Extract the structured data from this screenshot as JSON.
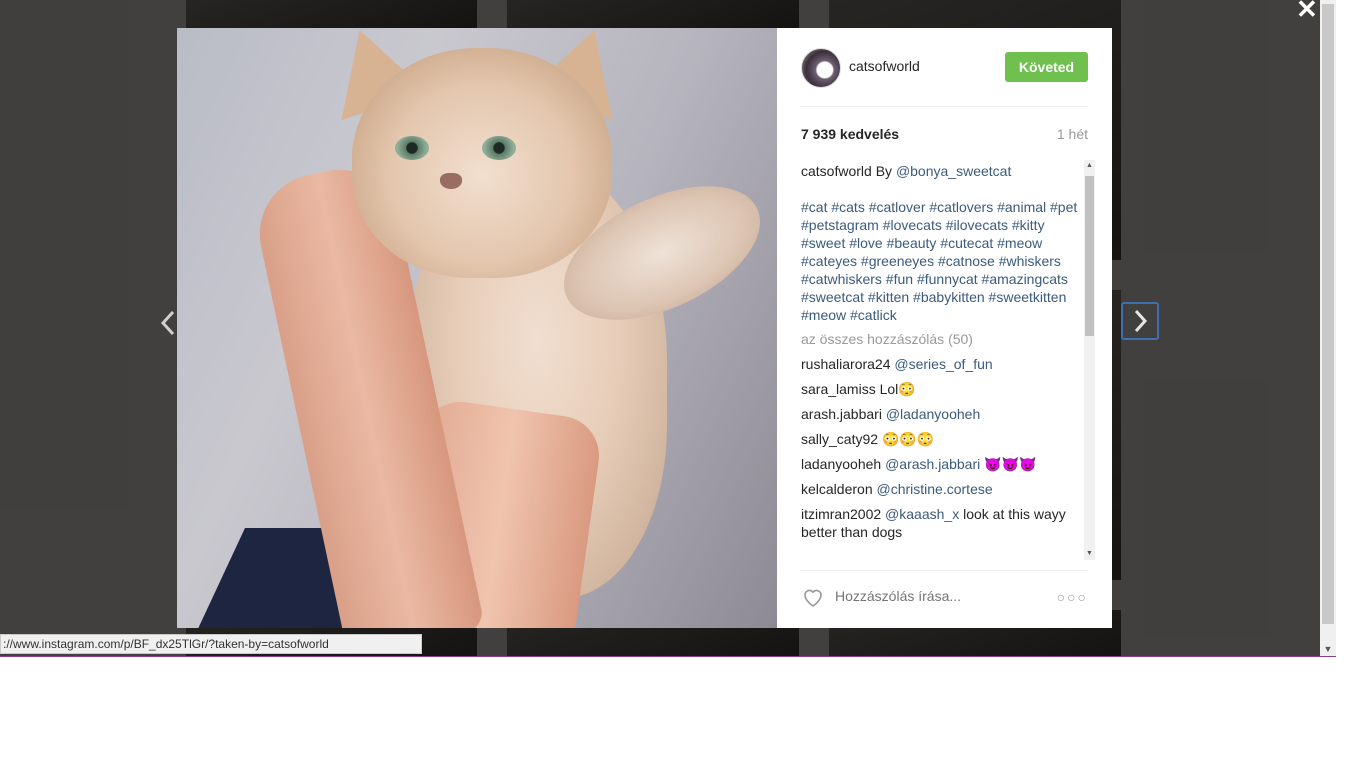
{
  "post": {
    "username": "catsofworld",
    "follow_label": "Követed",
    "likes": "7 939 kedvelés",
    "time": "1 hét",
    "caption_user": "catsofworld",
    "caption_text": "By",
    "caption_mention": "@bonya_sweetcat",
    "hashtags": "#cat #cats #catlover #catlovers #animal #pet #petstagram #lovecats #ilovecats #kitty #sweet #love #beauty #cutecat #meow #cateyes #greeneyes #catnose #whiskers #catwhiskers #fun #funnycat #amazingcats #sweetcat #kitten #babykitten #sweetkitten #meow #catlick",
    "all_comments": "az összes hozzászólás (50)",
    "comments": [
      {
        "user": "rushaliarora24",
        "mention": "@series_of_fun",
        "text": ""
      },
      {
        "user": "sara_lamiss",
        "mention": "",
        "text": "Lol😳"
      },
      {
        "user": "arash.jabbari",
        "mention": "@ladanyooheh",
        "text": ""
      },
      {
        "user": "sally_caty92",
        "mention": "",
        "text": "😳😳😳"
      },
      {
        "user": "ladanyooheh",
        "mention": "@arash.jabbari",
        "text": "😈😈😈"
      },
      {
        "user": "kelcalderon",
        "mention": "@christine.cortese",
        "text": ""
      },
      {
        "user": "itzimran2002",
        "mention": "@kaaash_x",
        "text": "look at this wayy better than dogs"
      }
    ],
    "comment_placeholder": "Hozzászólás írása...",
    "more_label": "○○○"
  },
  "ui": {
    "close_label": "✕",
    "status_url": "://www.instagram.com/p/BF_dx25TlGr/?taken-by=catsofworld",
    "scroll_up": "▲",
    "scroll_down": "▼"
  },
  "colors": {
    "follow_button": "#70c050",
    "link": "#3b5b7c",
    "overlay": "rgba(0,0,0,0.72)",
    "nav_focus": "#3f6fb0"
  }
}
